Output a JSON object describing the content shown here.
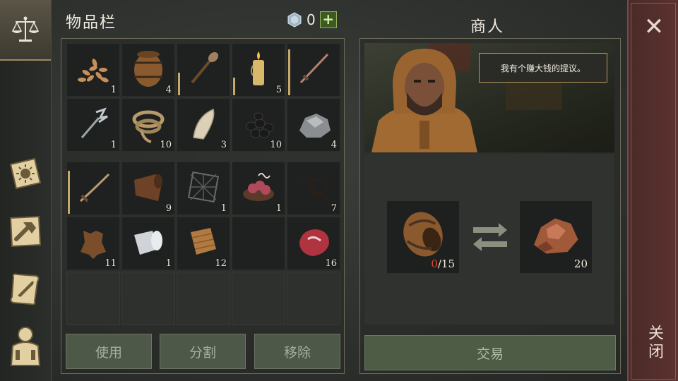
{
  "inventory": {
    "title": "物品栏",
    "currency": {
      "value": "0",
      "plus": "+"
    },
    "slots": [
      {
        "icon": "seeds-icon",
        "count": "1"
      },
      {
        "icon": "barrel-icon",
        "count": "4"
      },
      {
        "icon": "mace-icon",
        "count": "",
        "durability": 0.45
      },
      {
        "icon": "candle-icon",
        "count": "5",
        "durability": 0.35
      },
      {
        "icon": "sword-icon",
        "count": "",
        "durability": 0.9
      },
      {
        "icon": "trident-icon",
        "count": "1"
      },
      {
        "icon": "rope-icon",
        "count": "10"
      },
      {
        "icon": "fang-icon",
        "count": "3"
      },
      {
        "icon": "coal-icon",
        "count": "10"
      },
      {
        "icon": "stone-icon",
        "count": "4"
      },
      {
        "icon": "sabre-icon",
        "count": "",
        "durability": 0.85
      },
      {
        "icon": "leather-roll-icon",
        "count": "9"
      },
      {
        "icon": "net-icon",
        "count": "1"
      },
      {
        "icon": "entrails-icon",
        "count": "1"
      },
      {
        "icon": "wire-icon",
        "count": "7"
      },
      {
        "icon": "hide-icon",
        "count": "11"
      },
      {
        "icon": "cloth-icon",
        "count": "1"
      },
      {
        "icon": "burlap-icon",
        "count": "12"
      },
      {
        "icon": "empty",
        "count": ""
      },
      {
        "icon": "meat-icon",
        "count": "16"
      }
    ],
    "buttons": {
      "use": "使用",
      "split": "分割",
      "remove": "移除"
    }
  },
  "merchant": {
    "title": "商人",
    "speech": "我有个赚大钱的提议。",
    "give": {
      "icon": "barrel-icon",
      "have": "0",
      "need": "/15"
    },
    "receive": {
      "icon": "copper-ore-icon",
      "count": "20"
    },
    "trade_button": "交易"
  },
  "close": {
    "symbol": "✕",
    "label": "关闭"
  },
  "colors": {
    "accent_gold": "#c8a86a",
    "button_green": "#4e5c45",
    "close_red": "#5c3230",
    "missing_red": "#e0482f"
  }
}
